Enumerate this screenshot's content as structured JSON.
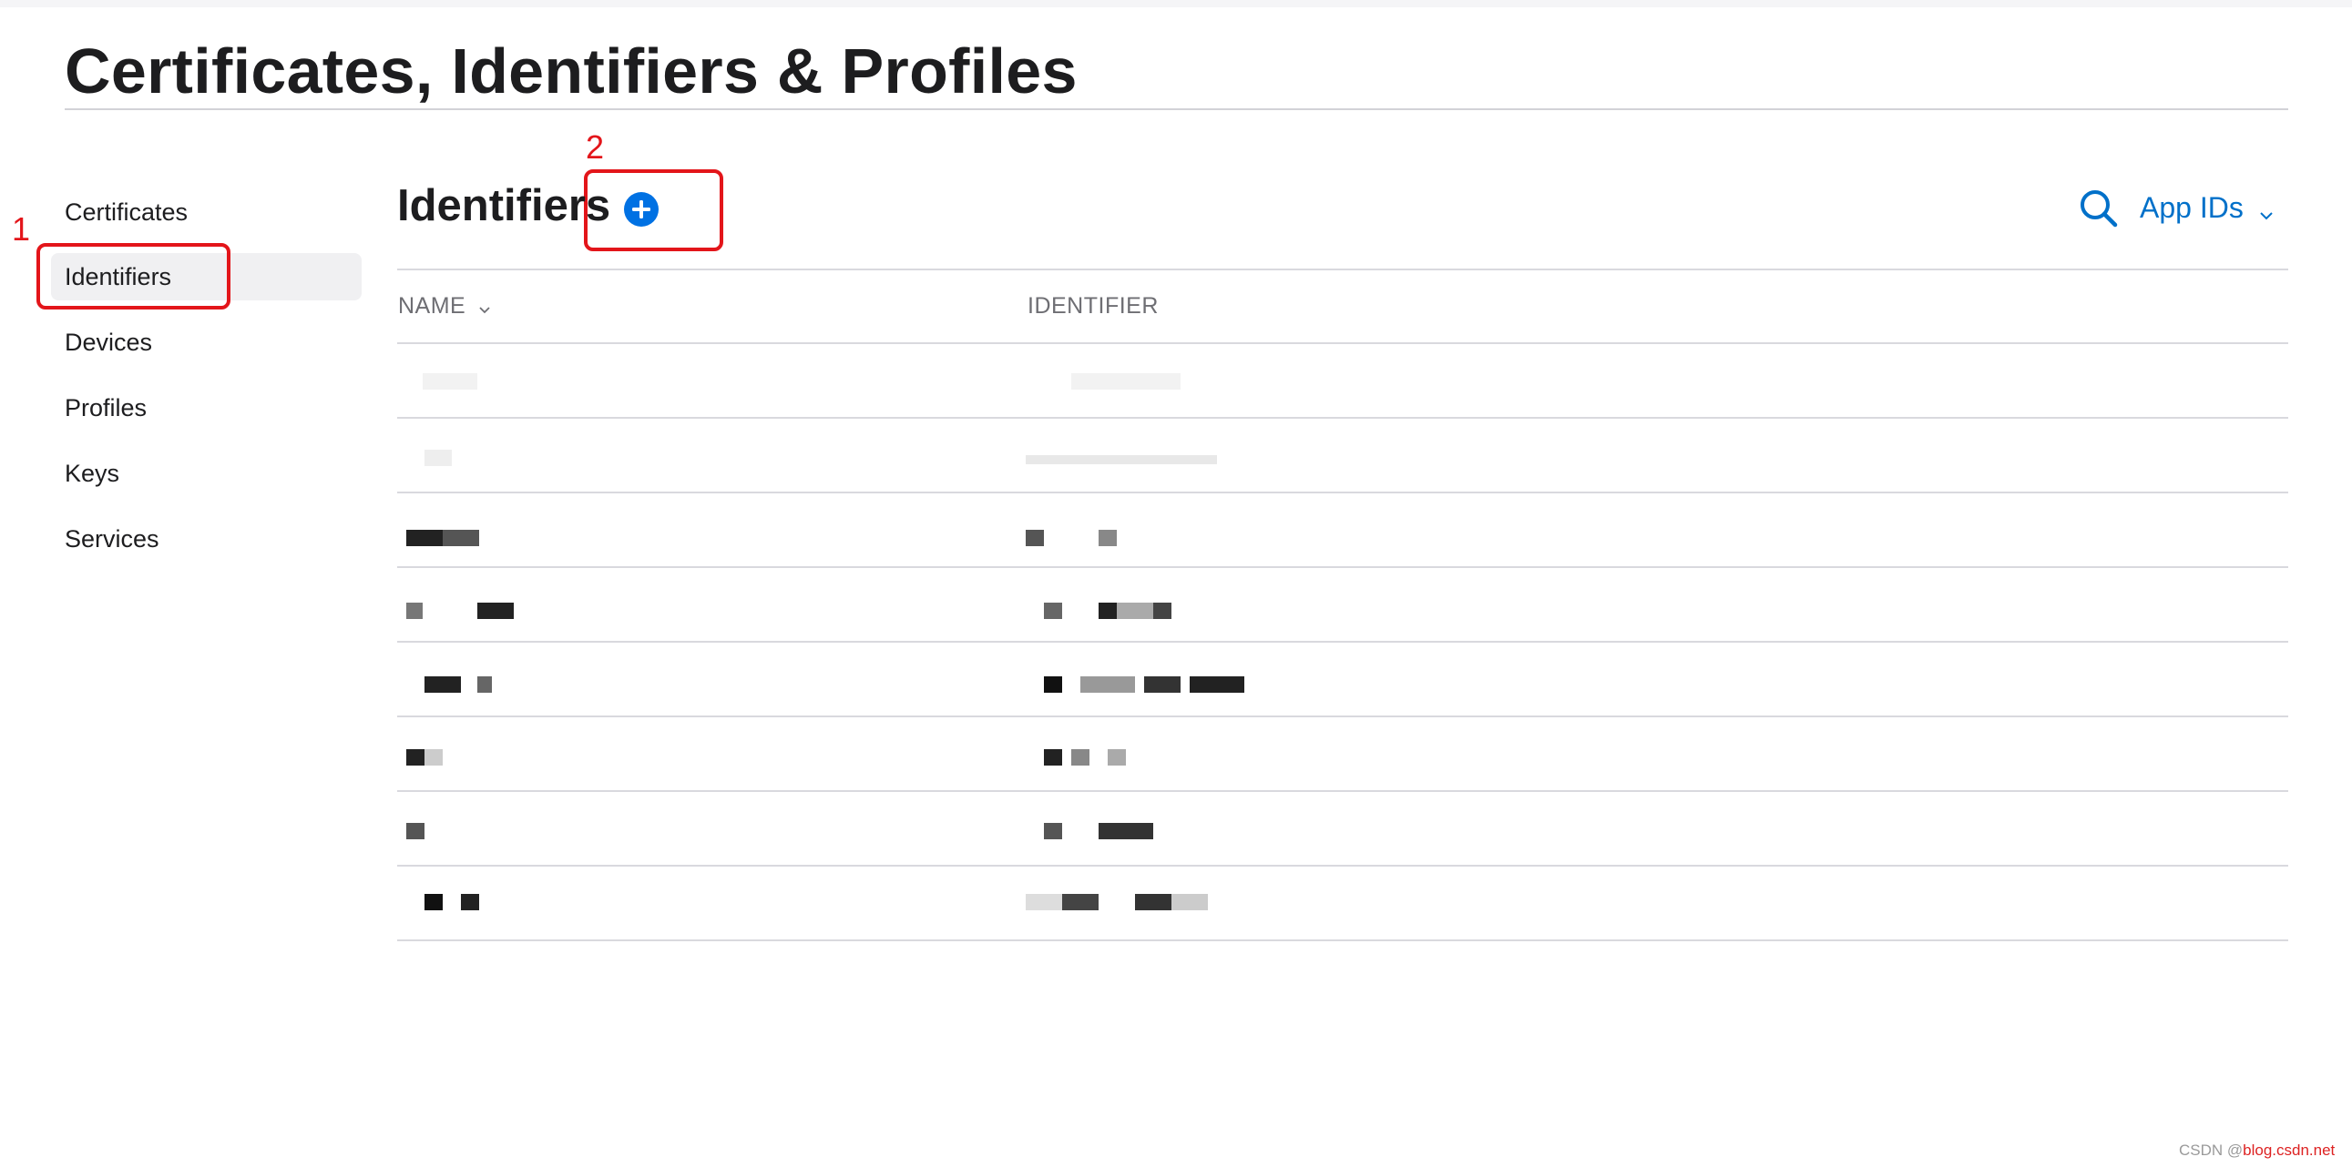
{
  "page": {
    "title": "Certificates, Identifiers & Profiles"
  },
  "sidebar": {
    "items": [
      {
        "label": "Certificates",
        "active": false
      },
      {
        "label": "Identifiers",
        "active": true
      },
      {
        "label": "Devices",
        "active": false
      },
      {
        "label": "Profiles",
        "active": false
      },
      {
        "label": "Keys",
        "active": false
      },
      {
        "label": "Services",
        "active": false
      }
    ]
  },
  "main": {
    "section_title": "Identifiers",
    "add_icon": "plus-circle-icon",
    "search_icon": "search-icon",
    "filter_label": "App IDs",
    "columns": {
      "name": "NAME",
      "identifier": "IDENTIFIER"
    },
    "rows_note_redacted": true
  },
  "annotations": {
    "one": "1",
    "two": "2"
  },
  "watermark": {
    "prefix": "CSDN @",
    "suffix": "blog.csdn.net"
  },
  "colors": {
    "accent": "#0071e3",
    "link": "#0070c9",
    "annotation": "#e3151a",
    "active_bg": "#f0f0f2",
    "divider": "#d9d9de"
  }
}
